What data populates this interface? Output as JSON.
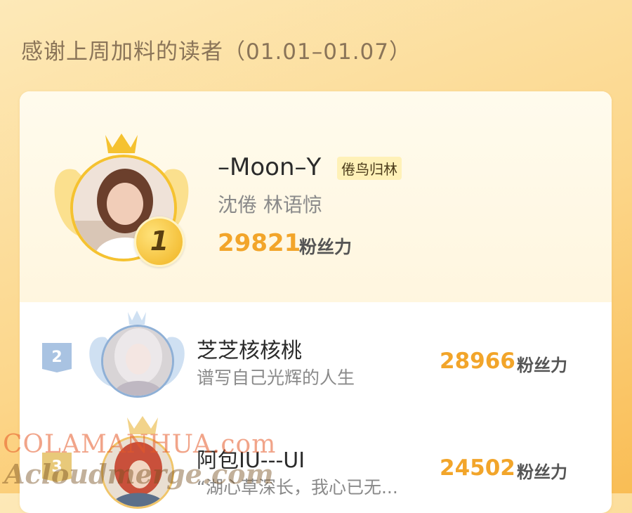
{
  "title": "感谢上周加料的读者（01.01–01.07）",
  "top_reader": {
    "rank": "1",
    "name": "–Moon–Y",
    "tag": "倦鸟归林",
    "subtitle": "沈倦 林语惊",
    "score": "29821",
    "unit": "粉丝力"
  },
  "readers": [
    {
      "rank": "2",
      "name": "芝芝核核桃",
      "subtitle": "谱写自己光辉的人生",
      "score": "28966",
      "unit": "粉丝力"
    },
    {
      "rank": "3",
      "name": "阿包IU---UI",
      "subtitle": "“湖心草深长，我心已无...",
      "score": "24502",
      "unit": "粉丝力"
    }
  ],
  "watermark": {
    "line1": "COLAMANHUA.com",
    "line2": "Acloudmerge.com"
  },
  "colors": {
    "score": "#f2a52a",
    "gold": "#f5c230",
    "silver_blue": "#8fb0d6"
  }
}
